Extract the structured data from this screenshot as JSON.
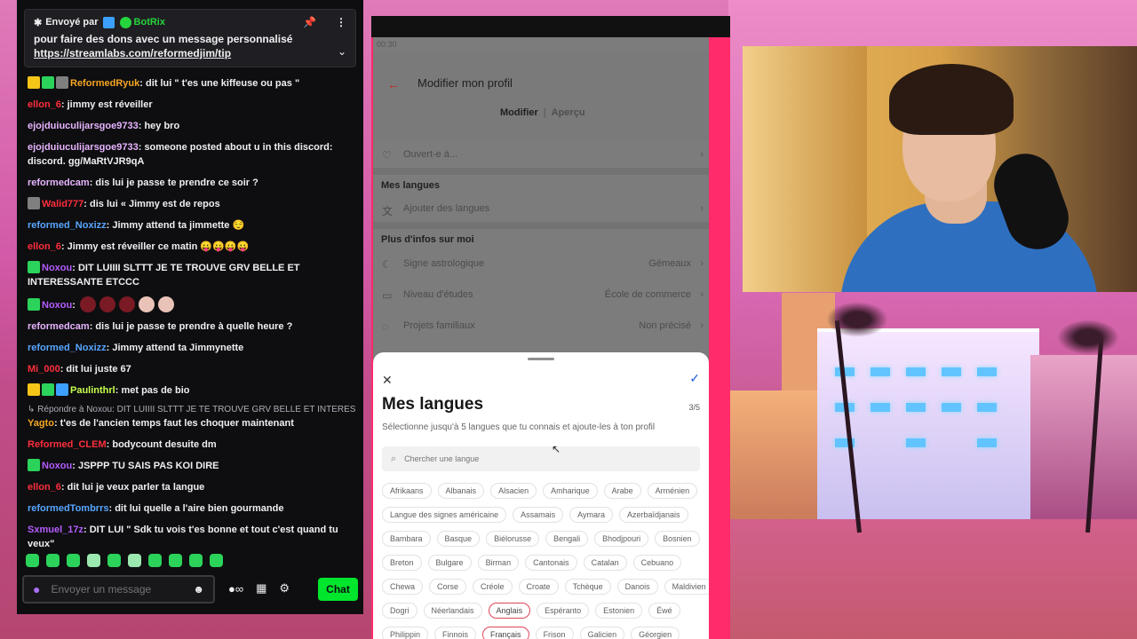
{
  "pinned": {
    "prefix": "Envoyé par",
    "sender": "BotRix",
    "text": "pour faire des dons avec un message personnalisé",
    "link": "https://streamlabs.com/reformedjim/tip"
  },
  "messages": [
    {
      "user": "ReformedRyuk",
      "color": "#f5a623",
      "badges": [
        "crown",
        "sub",
        "mod"
      ],
      "text": ": dit lui \" t'es une kiffeuse ou pas \""
    },
    {
      "user": "ellon_6",
      "color": "#ff2e3d",
      "text": ": jimmy est réveiller"
    },
    {
      "user": "ejojduiuculijarsgoe9733",
      "color": "#e7b4ff",
      "text": ": hey bro"
    },
    {
      "user": "ejojduiuculijarsgoe9733",
      "color": "#e7b4ff",
      "text": ": someone posted about u in this discord: discord. gg/MaRtVJR9qA"
    },
    {
      "user": "reformedcam",
      "color": "#e7b4ff",
      "text": ": dis lui je passe te prendre ce soir ?"
    },
    {
      "user": "Walid777",
      "color": "#ff2e3d",
      "badges": [
        "mod"
      ],
      "text": ": dis lui «  Jimmy est de repos"
    },
    {
      "user": "reformed_Noxizz",
      "color": "#57a6ff",
      "text": ": Jimmy attend ta jimmette 😌"
    },
    {
      "user": "ellon_6",
      "color": "#ff2e3d",
      "text": ": Jimmy est réveiller ce matin 😛😛😛😛"
    },
    {
      "user": "Noxou",
      "color": "#b45cff",
      "badges": [
        "sub"
      ],
      "text": ": DIT LUIIII SLTTT JE TE TROUVE GRV BELLE ET INTERESSANTE ETCCC"
    },
    {
      "user": "Noxou",
      "color": "#b45cff",
      "badges": [
        "sub"
      ],
      "text": ": ",
      "emotes": [
        "sit",
        "sit",
        "sit",
        "img",
        "img"
      ]
    },
    {
      "user": "reformedcam",
      "color": "#e7b4ff",
      "text": ": dis lui je passe te prendre à quelle heure ?"
    },
    {
      "user": "reformed_Noxizz",
      "color": "#57a6ff",
      "text": ": Jimmy attend ta Jimmynette"
    },
    {
      "user": "Mi_000",
      "color": "#ff2e3d",
      "text": ": dit lui juste 67"
    },
    {
      "user": "Paulinthrl",
      "color": "#c7ff4d",
      "badges": [
        "crown",
        "sub",
        "sub2"
      ],
      "text": ": met pas de bio"
    },
    {
      "reply": "↳ Répondre à Noxou: DIT LUIIII SLTTT JE TE TROUVE GRV BELLE ET INTERES...",
      "user": "Yagto",
      "color": "#f5a623",
      "text": ": t'es de l'ancien temps faut les choquer maintenant"
    },
    {
      "user": "Reformed_CLEM",
      "color": "#ff2e3d",
      "text": ": bodycount desuite dm"
    },
    {
      "user": "Noxou",
      "color": "#b45cff",
      "badges": [
        "sub"
      ],
      "text": ": JSPPP TU SAIS PAS KOI DIRE"
    },
    {
      "user": "ellon_6",
      "color": "#ff2e3d",
      "text": ": dit lui je veux parler ta langue"
    },
    {
      "user": "reformedTombrrs",
      "color": "#57a6ff",
      "text": ": dit lui quelle a l'aire bien gourmande"
    },
    {
      "user": "Sxmuel_17z",
      "color": "#b45cff",
      "text": ": DIT LUI \" Sdk tu vois t'es bonne et tout c'est quand tu veux\""
    }
  ],
  "chat_input": {
    "placeholder": "Envoyer un message"
  },
  "chat_button": "Chat",
  "phone": {
    "time": "00:30",
    "title": "Modifier mon profil",
    "tab_edit": "Modifier",
    "tab_preview": "Aperçu",
    "open_to": "Ouvert-e à...",
    "languages_section": "Mes langues",
    "add_languages": "Ajouter des langues",
    "more_section": "Plus d'infos sur moi",
    "rows": [
      {
        "label": "Signe astrologique",
        "value": "Gémeaux"
      },
      {
        "label": "Niveau d'études",
        "value": "École de commerce"
      },
      {
        "label": "Projets familiaux",
        "value": "Non précisé"
      }
    ]
  },
  "sheet": {
    "title": "Mes langues",
    "count": "3/5",
    "subtitle": "Sélectionne jusqu'à 5 langues que tu connais et ajoute-les à ton profil",
    "search_placeholder": "Chercher une langue",
    "rows": [
      [
        "Afrikaans",
        "Albanais",
        "Alsacien",
        "Amharique",
        "Arabe",
        "Arménien"
      ],
      [
        "Langue des signes américaine",
        "Assamais",
        "Aymara",
        "Azerbaïdjanais"
      ],
      [
        "Bambara",
        "Basque",
        "Biélorusse",
        "Bengali",
        "Bhodjpouri",
        "Bosnien"
      ],
      [
        "Breton",
        "Bulgare",
        "Birman",
        "Cantonais",
        "Catalan",
        "Cebuano"
      ],
      [
        "Chewa",
        "Corse",
        "Créole",
        "Croate",
        "Tchèque",
        "Danois",
        "Maldivien"
      ],
      [
        "Dogri",
        "Néerlandais",
        "Anglais",
        "Espéranto",
        "Estonien",
        "Éwé"
      ],
      [
        "Philippin",
        "Finnois",
        "Français",
        "Frison",
        "Galicien",
        "Géorgien"
      ]
    ],
    "selected": [
      "Anglais",
      "Français"
    ]
  }
}
